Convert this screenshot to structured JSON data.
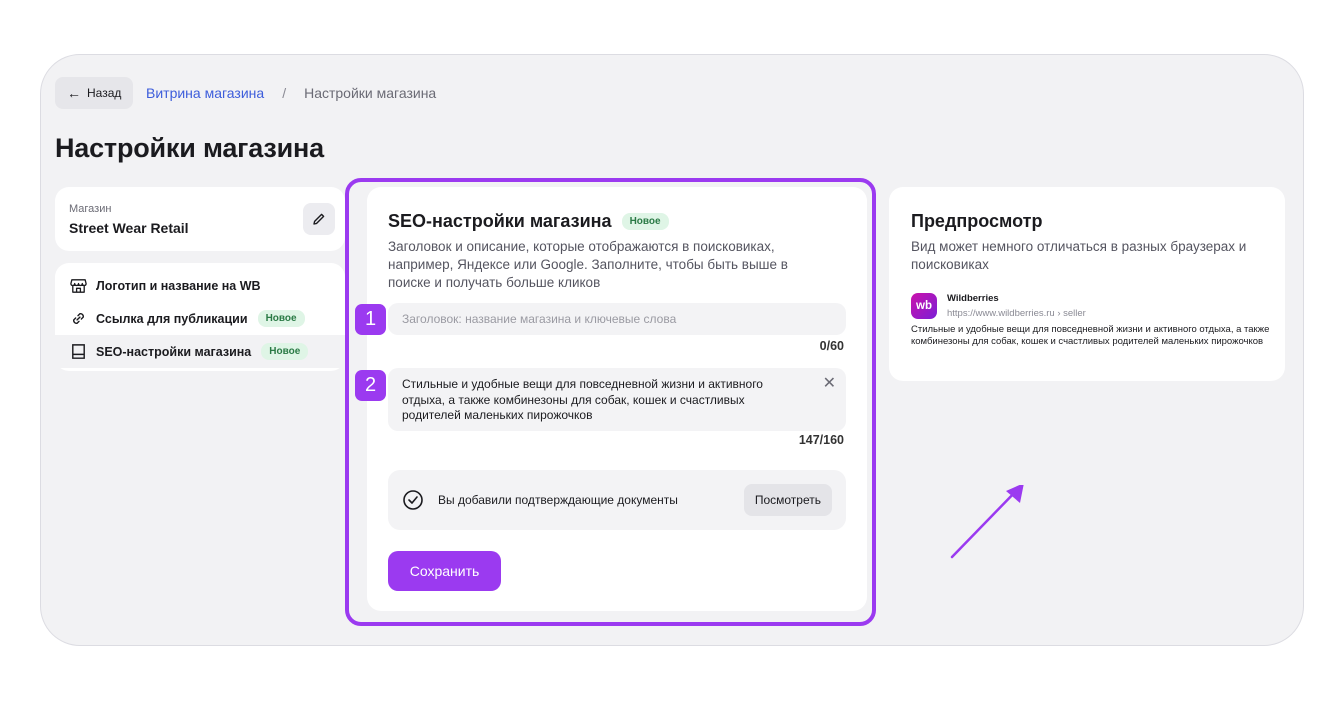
{
  "nav": {
    "back_label": "Назад",
    "breadcrumb_link": "Витрина магазина",
    "breadcrumb_separator": "/",
    "breadcrumb_current": "Настройки магазина"
  },
  "page_title": "Настройки магазина",
  "store": {
    "label": "Магазин",
    "name": "Street Wear Retail"
  },
  "sidebar": {
    "items": [
      {
        "label": "Логотип и название на WB",
        "icon": "store-icon",
        "badge": ""
      },
      {
        "label": "Ссылка для публикации",
        "icon": "link-icon",
        "badge": "Новое"
      },
      {
        "label": "SEO-настройки магазина",
        "icon": "seo-icon",
        "badge": "Новое"
      }
    ]
  },
  "seo": {
    "title": "SEO-настройки магазина",
    "badge": "Новое",
    "description": "Заголовок и описание, которые отображаются в поисковиках, например, Яндексе или Google. Заполните, чтобы быть выше в поиске и получать больше кликов",
    "title_placeholder": "Заголовок: название магазина и ключевые слова",
    "title_count": "0/60",
    "description_value": "Стильные и удобные вещи для повседневной жизни и активного отдыха, а также комбинезоны для собак, кошек и счастливых родителей маленьких пирожочков",
    "description_count": "147/160",
    "docs_text": "Вы добавили подтверждающие документы",
    "docs_button": "Посмотреть",
    "save_button": "Сохранить"
  },
  "markers": [
    "1",
    "2"
  ],
  "preview": {
    "title": "Предпросмотр",
    "description": "Вид может немного отличаться в разных браузерах и поисковиках",
    "logo_text": "wb",
    "site_name": "Wildberries",
    "site_url": "https://www.wildberries.ru › seller",
    "snippet": "Стильные и удобные вещи для повседневной жизни и активного отдыха, а также комбинезоны для собак, кошек и счастливых родителей маленьких пирожочков"
  },
  "colors": {
    "accent": "#9b3af0",
    "link": "#3d5ddb",
    "badge_bg": "#dff5e6",
    "badge_text": "#2a7a45",
    "panel_bg": "#f2f2f4"
  }
}
